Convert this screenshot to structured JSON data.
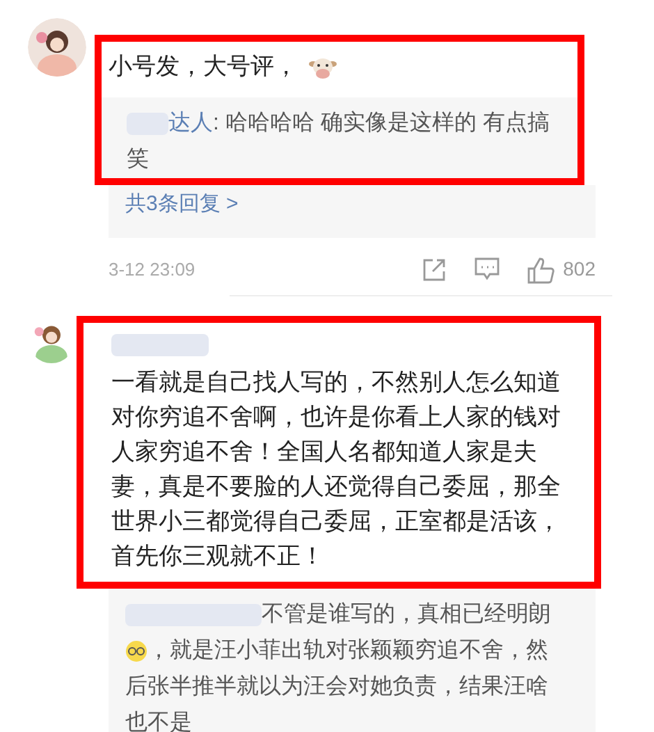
{
  "comments": [
    {
      "segments": [
        {
          "kind": "text",
          "text": "小号发，大号评，"
        },
        {
          "kind": "cow"
        }
      ],
      "reply": {
        "author": "达人",
        "separator": ": ",
        "segments": [
          {
            "kind": "text",
            "text": "哈哈哈哈 确实像是这样的  有点搞笑"
          }
        ]
      },
      "more_replies": "共3条回复 >",
      "time": "3-12 23:09",
      "likes": "802"
    },
    {
      "segments": [
        {
          "kind": "text",
          "text": "一看就是自己找人写的，不然别人怎么知道对你穷追不舍啊，也许是你看上人家的钱对人家穷追不舍！全国人名都知道人家是夫妻，真是不要脸的人还觉得自己委屈，那全世界小三都觉得自己委屈，正室都是活该，首先你三观就不正！"
        }
      ],
      "reply": {
        "segments": [
          {
            "kind": "text",
            "text": "不管是谁写的，真相已经明朗"
          },
          {
            "kind": "glasses"
          },
          {
            "kind": "text",
            "text": "，就是汪小菲出轨对张颖颖穷追不舍，然后张半推半就以为汪会对她负责，结果汪啥也不是"
          }
        ]
      }
    }
  ]
}
